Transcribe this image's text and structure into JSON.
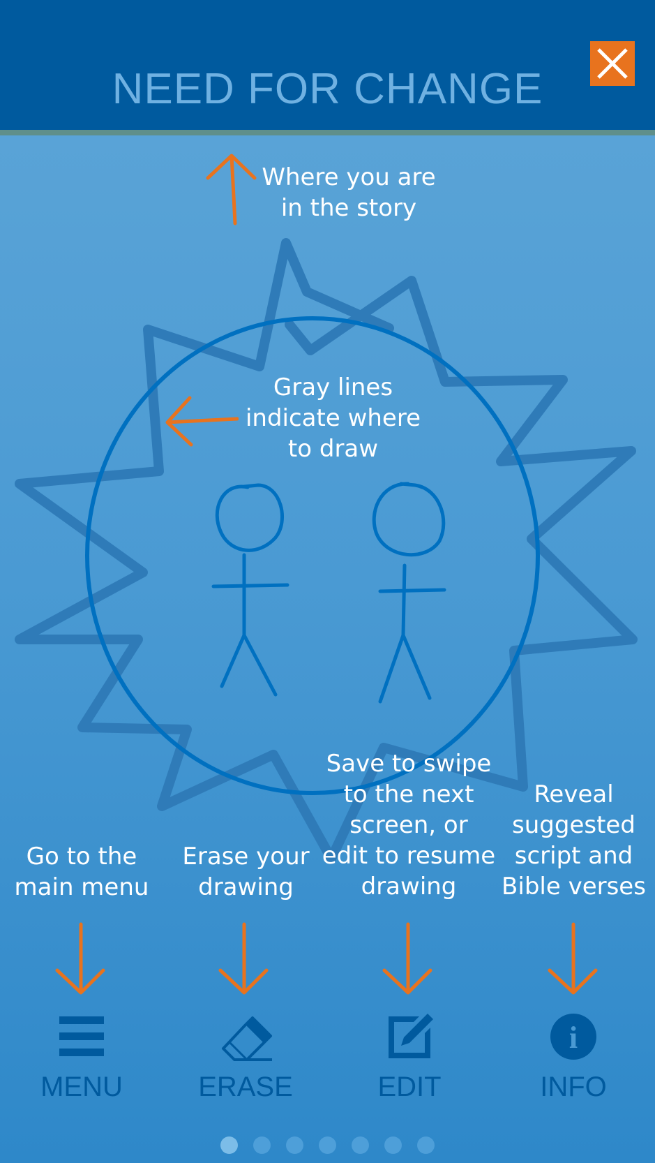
{
  "header": {
    "title": "NEED FOR CHANGE",
    "close_icon": "close-x-icon"
  },
  "hints": {
    "story_position": [
      "Where you are",
      "in the story"
    ],
    "gray_lines": [
      "Gray lines",
      "indicate where",
      "to draw"
    ],
    "menu": [
      "Go to the",
      "main menu"
    ],
    "erase": [
      "Erase your",
      "drawing"
    ],
    "edit": [
      "Save to swipe",
      "to the next",
      "screen, or",
      "edit to resume",
      "drawing"
    ],
    "info": [
      "Reveal",
      "suggested",
      "script and",
      "Bible verses"
    ]
  },
  "toolbar": {
    "menu_label": "MENU",
    "erase_label": "ERASE",
    "edit_label": "EDIT",
    "info_label": "INFO",
    "menu_icon": "hamburger-icon",
    "erase_icon": "eraser-icon",
    "edit_icon": "edit-icon",
    "info_icon": "info-icon"
  },
  "pagination": {
    "total": 7,
    "active": 1
  },
  "colors": {
    "header": "#005a9e",
    "accent": "#e8731e",
    "icon": "#005a9e",
    "hint_text": "#ffffff",
    "drawing_line": "#0070c0",
    "guide_line": "#2f7bb8"
  }
}
